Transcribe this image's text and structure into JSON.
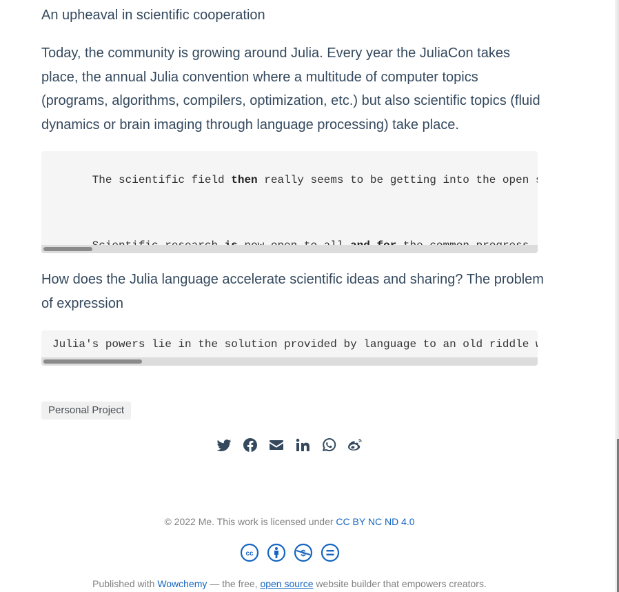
{
  "article": {
    "heading": "An upheaval in scientific cooperation",
    "paragraph": "Today, the community is growing around Julia. Every year the JuliaCon takes place, the annual Julia convention where a multitude of computer topics (programs, algorithms, compilers, optimization, etc.) but also scientific topics (fluid dynamics or brain imaging through language processing) take place.",
    "code_block_1": {
      "line1": {
        "a": "The scientific field ",
        "kw1": "then",
        "b": " really seems to be getting into the open source moveme"
      },
      "line2": {
        "a": "Scientific research ",
        "kw1": "is",
        "b": " now open to all ",
        "kw2": "and",
        "c": " ",
        "kw3": "for",
        "d": " the common progress. Many scienti"
      },
      "scroll_fraction": 0.1
    },
    "question": "How does the Julia language accelerate scientific ideas and sharing? The problem of expression",
    "code_block_2": {
      "line1": "Julia's powers lie in the solution provided by language to an old riddle well kn",
      "scroll_fraction": 0.2
    },
    "tag": "Personal Project"
  },
  "share_icons": [
    "twitter-icon",
    "facebook-icon",
    "email-icon",
    "linkedin-icon",
    "whatsapp-icon",
    "weibo-icon"
  ],
  "footer": {
    "license_text": "© 2022 Me. This work is licensed under ",
    "license_link": "CC BY NC ND 4.0",
    "cc_icons": [
      "cc-icon",
      "by-icon",
      "nc-icon",
      "nd-icon"
    ],
    "published_prefix": "Published with ",
    "wowchemy_link": "Wowchemy",
    "middle_text": " — the free, ",
    "open_source_link": "open source",
    "suffix": " website builder that empowers creators."
  },
  "colors": {
    "text": "#34495e",
    "link": "#1565c0",
    "code_bg": "#f5f5f5",
    "icon": "#34495e",
    "cc_icon": "#1565c0"
  }
}
